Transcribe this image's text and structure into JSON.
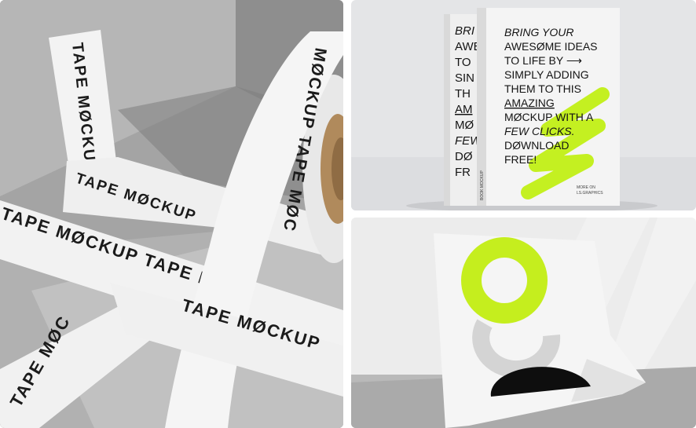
{
  "tape_mockup": {
    "tape_text": "TAPE MØCKUP",
    "tape_text_b": "TAPE MØCKUP",
    "tape_text_c": "MØCKUP TAPE MØC",
    "tape_text_d": "TAPE MØCKUP TAPE MØC",
    "tape_text_e": "TAPE MØC",
    "colors": {
      "tape": "#f3f3f3",
      "concrete": "#a9a9a9",
      "shadow": "#7d7d7d"
    }
  },
  "book_mockup": {
    "spine_lines": [
      "BRI",
      "AWE",
      "TO",
      "SIN",
      "TH",
      "AM",
      "MØ",
      "FEW",
      "DØ",
      "FR"
    ],
    "cover_lines": [
      "BRING YOUR",
      "AWESØME IDEAS",
      "TO LIFE BY ⟶",
      "SIMPLY ADDING",
      "THEM TO THIS",
      "AMAZING",
      "MØCKUP WITH A",
      "FEW CLICKS.",
      "DØWNLOAD",
      "FREE!"
    ],
    "cover_small": "MORE ON",
    "cover_small_2": "LS.GRAPHICS",
    "spine_small": "BOOK MOCKUP",
    "colors": {
      "accent": "#c4f021",
      "cover": "#f4f4f4",
      "background": "#e4e5e7"
    }
  },
  "poster_mockup": {
    "colors": {
      "accent": "#c5ee1e",
      "grey_shape": "#d4d4d4",
      "dark_shape": "#0e0e0e",
      "paper": "#f5f5f5",
      "wall": "#ececec"
    }
  }
}
